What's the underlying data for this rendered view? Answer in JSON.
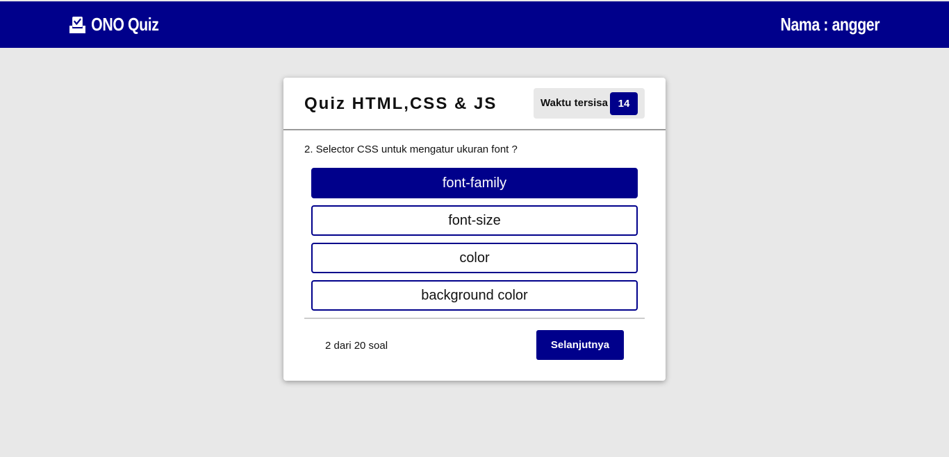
{
  "navbar": {
    "brand_icon": "inbox-check-icon",
    "brand_name": "ONO Quiz",
    "user_label": "Nama : angger",
    "background": "#00008b"
  },
  "quiz": {
    "title": "Quiz HTML,CSS & JS",
    "timer_label": "Waktu tersisa",
    "timer_value": "14",
    "question": "2. Selector CSS untuk mengatur ukuran font ?",
    "options": [
      {
        "label": "font-family",
        "selected": true
      },
      {
        "label": "font-size",
        "selected": false
      },
      {
        "label": "color",
        "selected": false
      },
      {
        "label": "background color",
        "selected": false
      }
    ],
    "progress_text": "2 dari 20 soal",
    "next_label": "Selanjutnya"
  },
  "colors": {
    "accent": "#00008b",
    "page_background": "#e8e8e8",
    "card_background": "#ffffff"
  }
}
